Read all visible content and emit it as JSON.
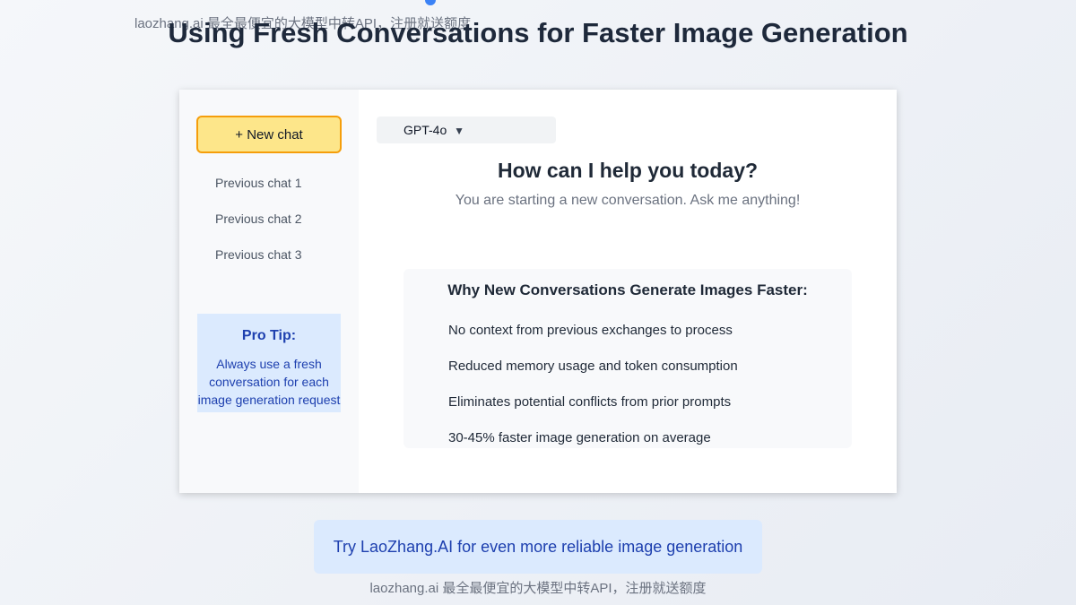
{
  "watermark": "laozhang.ai 最全最便宜的大模型中转API，注册就送额度",
  "page_title": "Using Fresh Conversations for Faster Image Generation",
  "sidebar": {
    "new_chat_label": "+ New chat",
    "history": [
      {
        "label": "Previous chat 1"
      },
      {
        "label": "Previous chat 2"
      },
      {
        "label": "Previous chat 3"
      }
    ],
    "pro_tip": {
      "title": "Pro Tip:",
      "lines": [
        "Always use a fresh",
        "conversation for each",
        "image generation request"
      ]
    }
  },
  "main": {
    "model_label": "GPT-4o",
    "model_icon": "chevron-down-icon",
    "heading": "How can I help you today?",
    "subtitle": "You are starting a new conversation. Ask me anything!",
    "card": {
      "title": "Why New Conversations Generate Images Faster:",
      "items": [
        "No context from previous exchanges to process",
        "Reduced memory usage and token consumption",
        "Eliminates potential conflicts from prior prompts",
        "30-45% faster image generation on average"
      ]
    }
  },
  "cta_label": "Try LaoZhang.AI for even more reliable image generation",
  "colors": {
    "accent": "#3b82f6",
    "new_chat_bg": "#fde68a",
    "new_chat_border": "#f59e0b",
    "tip_bg": "#dbeafe",
    "tip_text": "#1e40af"
  }
}
